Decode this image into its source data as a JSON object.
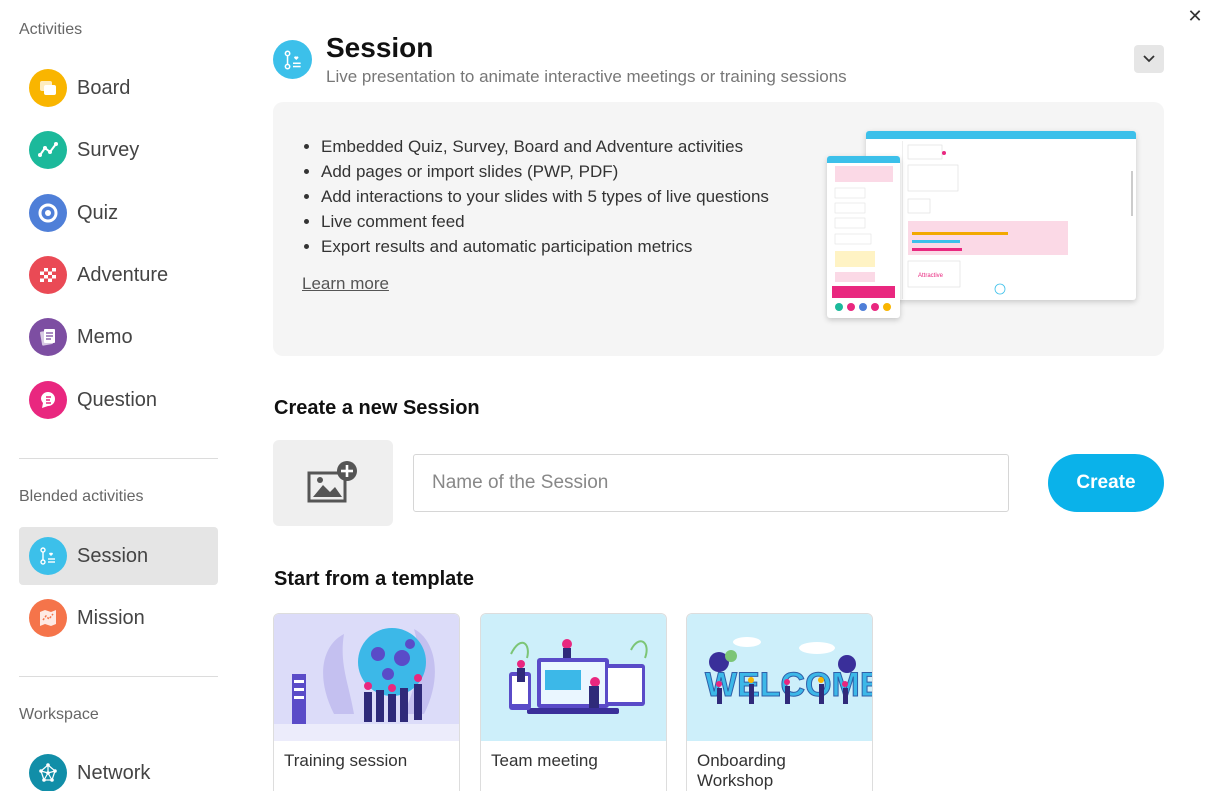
{
  "sidebar": {
    "activities_label": "Activities",
    "activities": [
      {
        "label": "Board",
        "icon": "board-icon",
        "color": "#f9b500"
      },
      {
        "label": "Survey",
        "icon": "survey-icon",
        "color": "#1cb99b"
      },
      {
        "label": "Quiz",
        "icon": "quiz-icon",
        "color": "#4f7fd8"
      },
      {
        "label": "Adventure",
        "icon": "adventure-icon",
        "color": "#ea4a55"
      },
      {
        "label": "Memo",
        "icon": "memo-icon",
        "color": "#7d4ea2"
      },
      {
        "label": "Question",
        "icon": "question-icon",
        "color": "#e9277f"
      }
    ],
    "blended_label": "Blended activities",
    "blended": [
      {
        "label": "Session",
        "icon": "session-icon",
        "color": "#3cc0ea",
        "active": true
      },
      {
        "label": "Mission",
        "icon": "mission-icon",
        "color": "#f5744a"
      }
    ],
    "workspace_label": "Workspace",
    "workspace": [
      {
        "label": "Network",
        "icon": "network-icon",
        "color": "#118ea8"
      }
    ]
  },
  "header": {
    "title": "Session",
    "subtitle": "Live presentation to animate interactive meetings or training sessions",
    "icon": "session-icon",
    "icon_color": "#3cc0ea"
  },
  "info": {
    "features": [
      "Embedded Quiz, Survey, Board and Adventure activities",
      "Add pages or import slides (PWP, PDF)",
      "Add interactions to your slides with 5 types of live questions",
      "Live comment feed",
      "Export results and automatic participation metrics"
    ],
    "learn_more": "Learn more"
  },
  "create": {
    "title": "Create a new Session",
    "name_placeholder": "Name of the Session",
    "name_value": "",
    "create_label": "Create"
  },
  "templates": {
    "title": "Start from a template",
    "items": [
      {
        "label": "Training session"
      },
      {
        "label": "Team meeting"
      },
      {
        "label": "Onboarding Workshop"
      }
    ]
  },
  "colors": {
    "accent": "#0ab2ea",
    "active_bg": "#e5e5e5"
  }
}
